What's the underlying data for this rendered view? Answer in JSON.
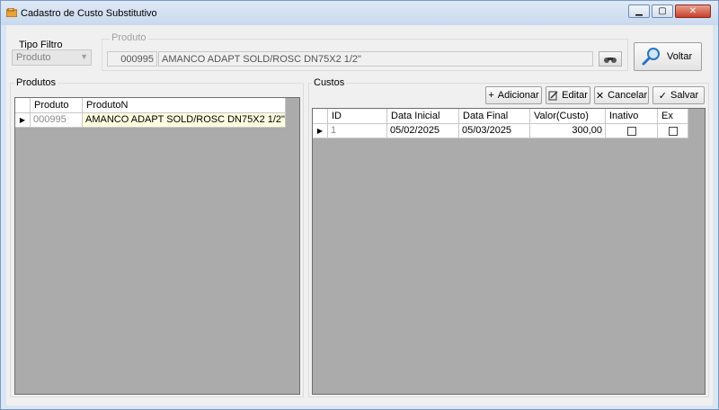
{
  "window": {
    "title": "Cadastro de Custo Substitutivo"
  },
  "filter": {
    "label": "Tipo Filtro",
    "selected": "Produto"
  },
  "produto": {
    "legend": "Produto",
    "code": "000995",
    "name": "AMANCO ADAPT SOLD/ROSC DN75X2 1/2\""
  },
  "voltar": {
    "label": "Voltar"
  },
  "produtos": {
    "title": "Produtos",
    "columns": [
      "Produto",
      "ProdutoN"
    ],
    "rows": [
      {
        "produto": "000995",
        "produton": "AMANCO ADAPT SOLD/ROSC DN75X2 1/2\""
      }
    ]
  },
  "custos": {
    "title": "Custos",
    "toolbar": {
      "add": "Adicionar",
      "edit": "Editar",
      "cancel": "Cancelar",
      "save": "Salvar"
    },
    "columns": [
      "ID",
      "Data Inicial",
      "Data Final",
      "Valor(Custo)",
      "Inativo",
      "Ex"
    ],
    "rows": [
      {
        "id": "1",
        "data_inicial": "05/02/2025",
        "data_final": "05/03/2025",
        "valor": "300,00",
        "inativo": false,
        "ex": false
      }
    ]
  }
}
